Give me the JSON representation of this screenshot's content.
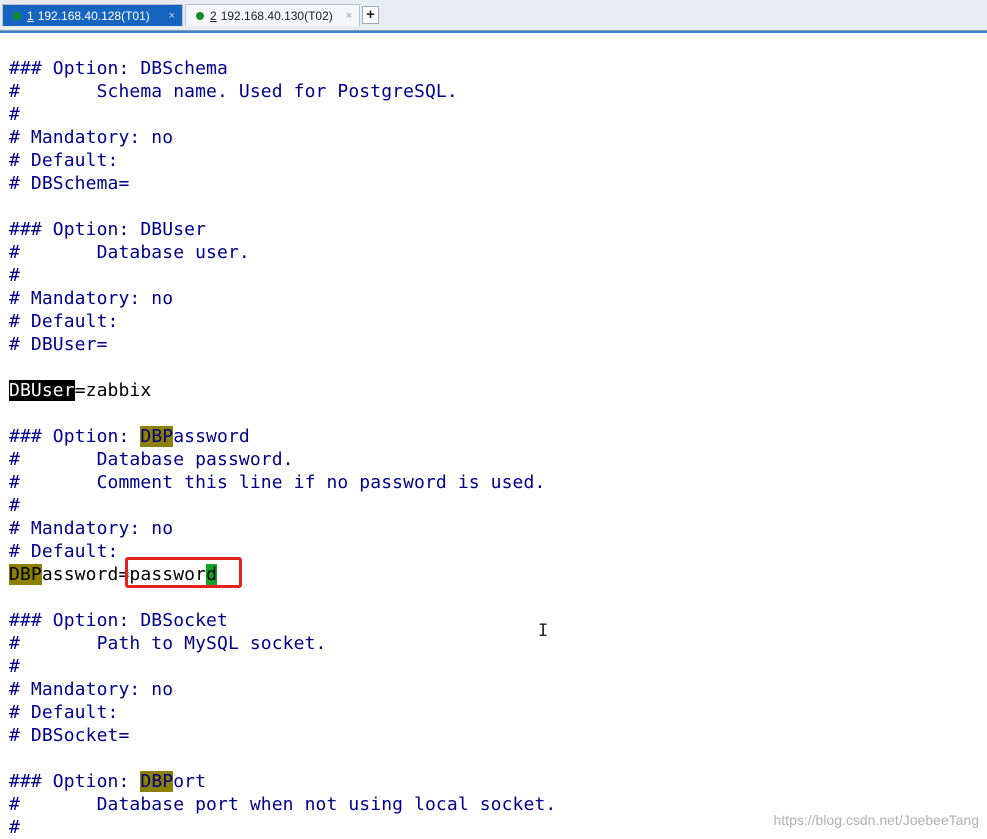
{
  "tabs": [
    {
      "num": "1",
      "label": "192.168.40.128(T01)",
      "close": "×"
    },
    {
      "num": "2",
      "label": "192.168.40.130(T02)",
      "close": "×"
    }
  ],
  "new_tab_label": "+",
  "terminal": {
    "lines": [
      "### Option: DBSchema",
      "#       Schema name. Used for PostgreSQL.",
      "#",
      "# Mandatory: no",
      "# Default:",
      "# DBSchema=",
      "",
      "### Option: DBUser",
      "#       Database user.",
      "#",
      "# Mandatory: no",
      "# Default:",
      "# DBUser=",
      "",
      "",
      "",
      "### Option: DBPassword",
      "#       Database password.",
      "#       Comment this line if no password is used.",
      "#",
      "# Mandatory: no",
      "# Default:",
      "",
      "",
      "### Option: DBSocket",
      "#       Path to MySQL socket.",
      "#",
      "# Mandatory: no",
      "# Default:",
      "# DBSocket=",
      "",
      "### Option: DBPort",
      "#       Database port when not using local socket.",
      "#"
    ],
    "dbuser_line": {
      "key": "DBUser",
      "rest": "=zabbix"
    },
    "dbpassword_header": {
      "prefix": "### Option: ",
      "match": "DBP",
      "rest": "assword"
    },
    "dbpassword_line": {
      "match": "DBP",
      "key_rest": "assword=",
      "value": "passwor",
      "cursor": "d"
    },
    "dbport_header": {
      "prefix": "### Option: ",
      "match": "DBP",
      "rest": "ort"
    }
  },
  "colors": {
    "comment": "#00008b",
    "search_highlight": "#8b8000",
    "cursor": "#12a12a",
    "annotation_box": "#e3211f",
    "active_tab": "#1565c0"
  },
  "watermark": "https://blog.csdn.net/JoebeeTang"
}
